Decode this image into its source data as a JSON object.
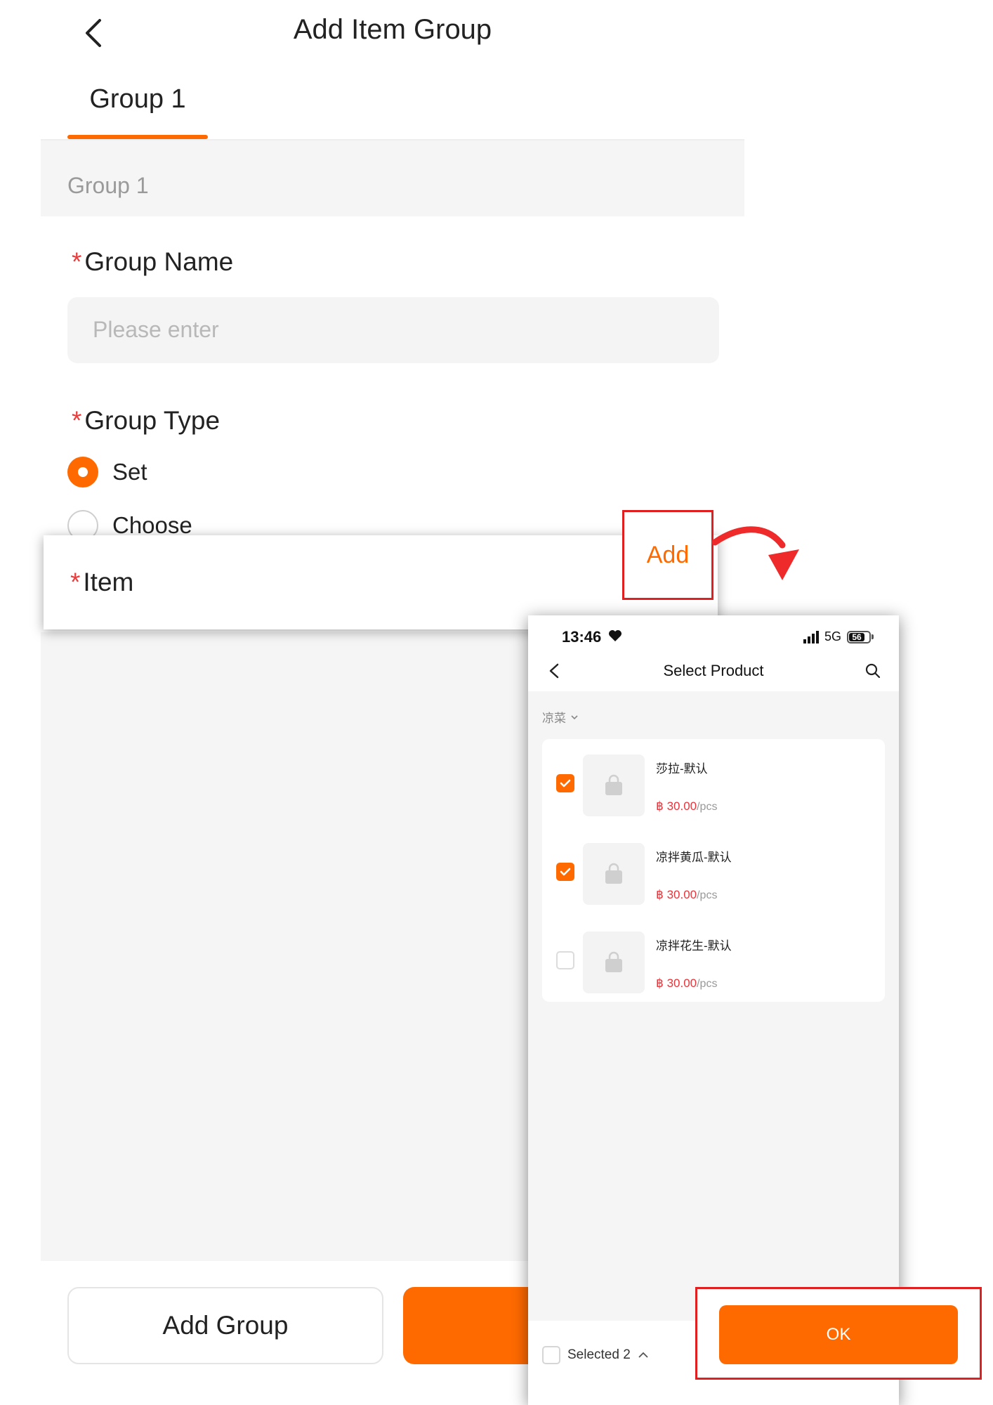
{
  "header": {
    "title": "Add Item Group",
    "back_icon": "chevron-left-icon"
  },
  "tabs": [
    {
      "label": "Group 1",
      "active": true
    }
  ],
  "section": {
    "label": "Group 1"
  },
  "form": {
    "group_name": {
      "required_mark": "*",
      "label": "Group Name",
      "placeholder": "Please enter",
      "value": ""
    },
    "group_type": {
      "required_mark": "*",
      "label": "Group Type",
      "options": [
        {
          "label": "Set",
          "selected": true
        },
        {
          "label": "Choose",
          "selected": false
        }
      ]
    },
    "item": {
      "required_mark": "*",
      "label": "Item",
      "add_label": "Add"
    }
  },
  "footer": {
    "add_group_label": "Add Group"
  },
  "phone": {
    "status": {
      "time": "13:46",
      "network": "5G",
      "battery": "56"
    },
    "title": "Select Product",
    "category": "凉菜",
    "products": [
      {
        "name": "莎拉-默认",
        "currency": "฿",
        "price": "30.00",
        "unit": "/pcs",
        "checked": true
      },
      {
        "name": "凉拌黄瓜-默认",
        "currency": "฿",
        "price": "30.00",
        "unit": "/pcs",
        "checked": true
      },
      {
        "name": "凉拌花生-默认",
        "currency": "฿",
        "price": "30.00",
        "unit": "/pcs",
        "checked": false
      }
    ],
    "selected_label": "Selected 2",
    "ok_label": "OK"
  },
  "colors": {
    "accent": "#ff6a00",
    "required": "#ee3a3a",
    "price": "#e8343a",
    "highlight": "#e02020"
  }
}
